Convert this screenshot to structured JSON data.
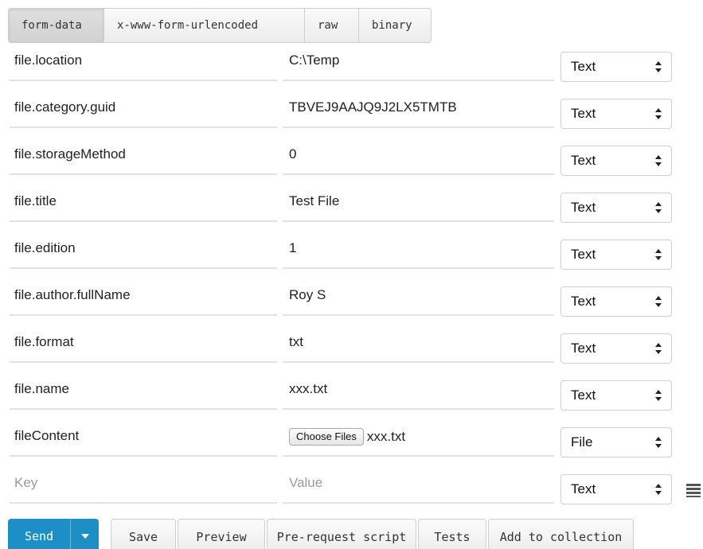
{
  "body_modes": {
    "tabs": [
      {
        "label": "form-data",
        "active": true
      },
      {
        "label": "x-www-form-urlencoded",
        "active": false
      },
      {
        "label": "raw",
        "active": false
      },
      {
        "label": "binary",
        "active": false
      }
    ]
  },
  "form_rows": [
    {
      "key": "file.location",
      "value": "C:\\Temp",
      "type": "Text"
    },
    {
      "key": "file.category.guid",
      "value": "TBVEJ9AAJQ9J2LX5TMTB",
      "type": "Text"
    },
    {
      "key": "file.storageMethod",
      "value": "0",
      "type": "Text"
    },
    {
      "key": "file.title",
      "value": "Test File",
      "type": "Text"
    },
    {
      "key": "file.edition",
      "value": "1",
      "type": "Text"
    },
    {
      "key": "file.author.fullName",
      "value": "Roy S",
      "type": "Text"
    },
    {
      "key": "file.format",
      "value": "txt",
      "type": "Text"
    },
    {
      "key": "file.name",
      "value": "xxx.txt",
      "type": "Text"
    },
    {
      "key": "fileContent",
      "choose_label": "Choose Files",
      "file_name": "xxx.txt",
      "type": "File"
    }
  ],
  "new_row": {
    "key_placeholder": "Key",
    "value_placeholder": "Value",
    "type": "Text",
    "bulk_icon": "bulk-edit-icon"
  },
  "footer": {
    "send_label": "Send",
    "save_label": "Save",
    "preview_label": "Preview",
    "prerequest_label": "Pre-request script",
    "tests_label": "Tests",
    "collection_label": "Add to collection"
  },
  "colors": {
    "send_button": "#1b8fc6",
    "border": "#cfcfcf",
    "placeholder": "#9a9a9a"
  }
}
